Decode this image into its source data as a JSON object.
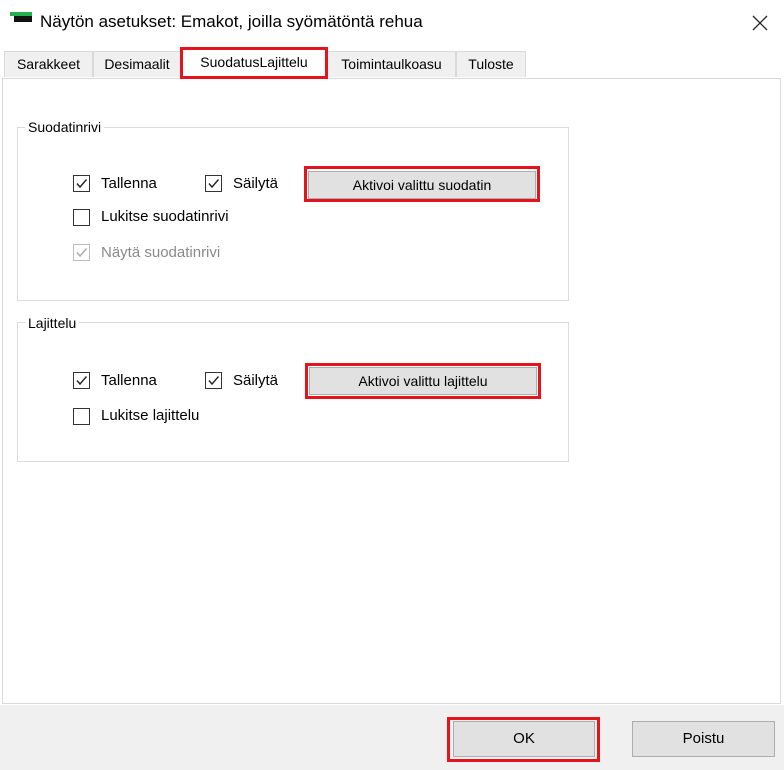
{
  "window": {
    "title": "Näytön asetukset: Emakot, joilla syömätöntä rehua",
    "close_glyph": "✕"
  },
  "icons": {
    "app": "app-icon",
    "close": "close-icon",
    "check": "check-icon"
  },
  "colors": {
    "highlight": "#e3141b",
    "button_face": "#e1e1e1",
    "brand_green": "#22b14c"
  },
  "tabs": [
    "Sarakkeet",
    "Desimaalit",
    "SuodatusLajittelu",
    "Toimintaulkoasu",
    "Tuloste"
  ],
  "active_tab": "SuodatusLajittelu",
  "filter_group": {
    "title": "Suodatinrivi",
    "save_label": "Tallenna",
    "save_checked": true,
    "keep_label": "Säilytä",
    "keep_checked": true,
    "activate_button": "Aktivoi valittu suodatin",
    "lock_label": "Lukitse suodatinrivi",
    "lock_checked": false,
    "show_label": "Näytä suodatinrivi",
    "show_checked": true,
    "show_enabled": false
  },
  "sort_group": {
    "title": "Lajittelu",
    "save_label": "Tallenna",
    "save_checked": true,
    "keep_label": "Säilytä",
    "keep_checked": true,
    "activate_button": "Aktivoi valittu lajittelu",
    "lock_label": "Lukitse lajittelu",
    "lock_checked": false
  },
  "footer": {
    "ok_label": "OK",
    "remove_label": "Poistu"
  }
}
